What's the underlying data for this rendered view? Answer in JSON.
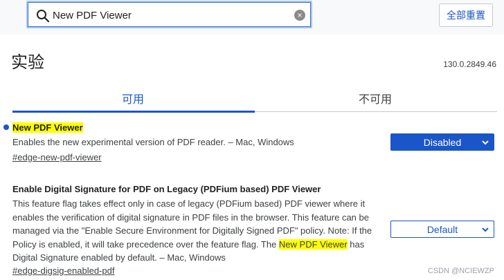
{
  "search": {
    "value": "New PDF Viewer",
    "clear_label": "×"
  },
  "header": {
    "reset_all_label": "全部重置",
    "title": "实验",
    "version": "130.0.2849.46"
  },
  "tabs": [
    {
      "label": "可用",
      "active": true
    },
    {
      "label": "不可用",
      "active": false
    }
  ],
  "experiments": [
    {
      "title": "New PDF Viewer",
      "description": "Enables the new experimental version of PDF reader. – Mac, Windows",
      "link": "#edge-new-pdf-viewer",
      "state": "Disabled",
      "modified": true
    },
    {
      "title": "Enable Digital Signature for PDF on Legacy (PDFium based) PDF Viewer",
      "description_lines": [
        "This feature flag takes effect only in case of legacy (PDFium based) PDF viewer where it",
        "enables the verification of digital signature in PDF files in the browser. This feature can be",
        "managed via the \"Enable Secure Environment for Digitally Signed PDF\" policy. Note: If the",
        "Policy is enabled, it will take precedence over the feature flag. The ",
        "New PDF Viewer",
        " has",
        "Digital Signature enabled by default. – Mac, Windows"
      ],
      "link": "#edge-digsig-enabled-pdf",
      "state": "Default",
      "modified": false
    }
  ],
  "watermark": "CSDN @NCIEWZP",
  "colors": {
    "accent": "#1a55c9",
    "highlight": "#ffff00"
  }
}
